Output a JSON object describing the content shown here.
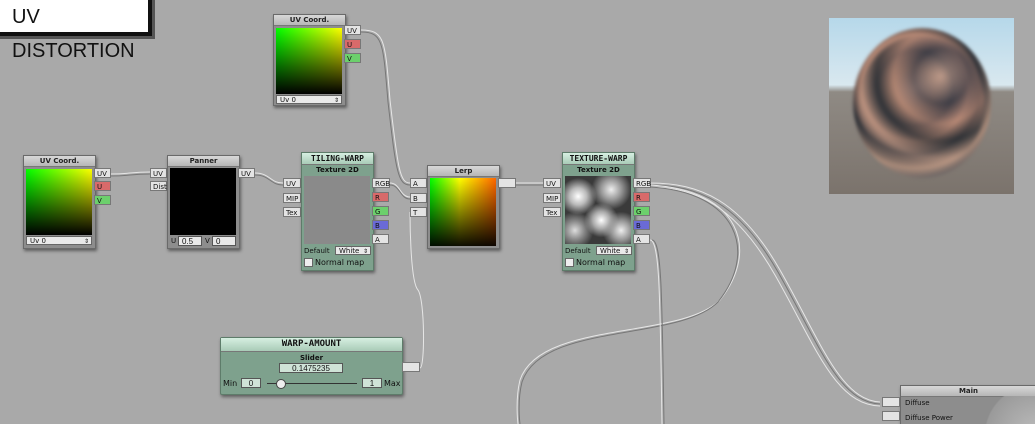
{
  "canvas_title": "UV DISTORTION",
  "colors": {
    "canvas_bg": "#a9a9a9",
    "node_bg": "#8d8d8d",
    "texture_node_bg": "#7ea18d",
    "wire": "#e8e8e8"
  },
  "nodes": {
    "uv_coord_top": {
      "title": "UV Coord.",
      "outputs": [
        "UV",
        "U",
        "V"
      ],
      "channel_select": "Uv 0"
    },
    "uv_coord_left": {
      "title": "UV Coord.",
      "outputs": [
        "UV",
        "U",
        "V"
      ],
      "channel_select": "Uv 0"
    },
    "panner": {
      "title": "Panner",
      "inputs": [
        "UV",
        "Dist"
      ],
      "outputs": [
        "UV"
      ],
      "u_label": "U",
      "u_value": "0.5",
      "v_label": "V",
      "v_value": "0"
    },
    "tiling_warp": {
      "title": "TILING-WARP",
      "subtitle": "Texture 2D",
      "inputs": [
        "UV",
        "MIP",
        "Tex"
      ],
      "outputs": [
        "RGB",
        "R",
        "G",
        "B",
        "A"
      ],
      "default_label": "Default",
      "default_value": "White",
      "normal_map": "Normal map"
    },
    "lerp": {
      "title": "Lerp",
      "inputs": [
        "A",
        "B",
        "T"
      ]
    },
    "texture_warp": {
      "title": "TEXTURE-WARP",
      "subtitle": "Texture 2D",
      "inputs": [
        "UV",
        "MIP",
        "Tex"
      ],
      "outputs": [
        "RGB",
        "R",
        "G",
        "B",
        "A"
      ],
      "default_label": "Default",
      "default_value": "White",
      "normal_map": "Normal map"
    },
    "warp_amount": {
      "title": "WARP-AMOUNT",
      "subtitle": "Slider",
      "value": "0.1475235",
      "min_label": "Min",
      "min_value": "0",
      "max_value": "1",
      "max_label": "Max",
      "slider_position": 0.1475235
    },
    "main": {
      "title": "Main",
      "inputs": [
        "Diffuse",
        "Diffuse Power"
      ]
    }
  }
}
